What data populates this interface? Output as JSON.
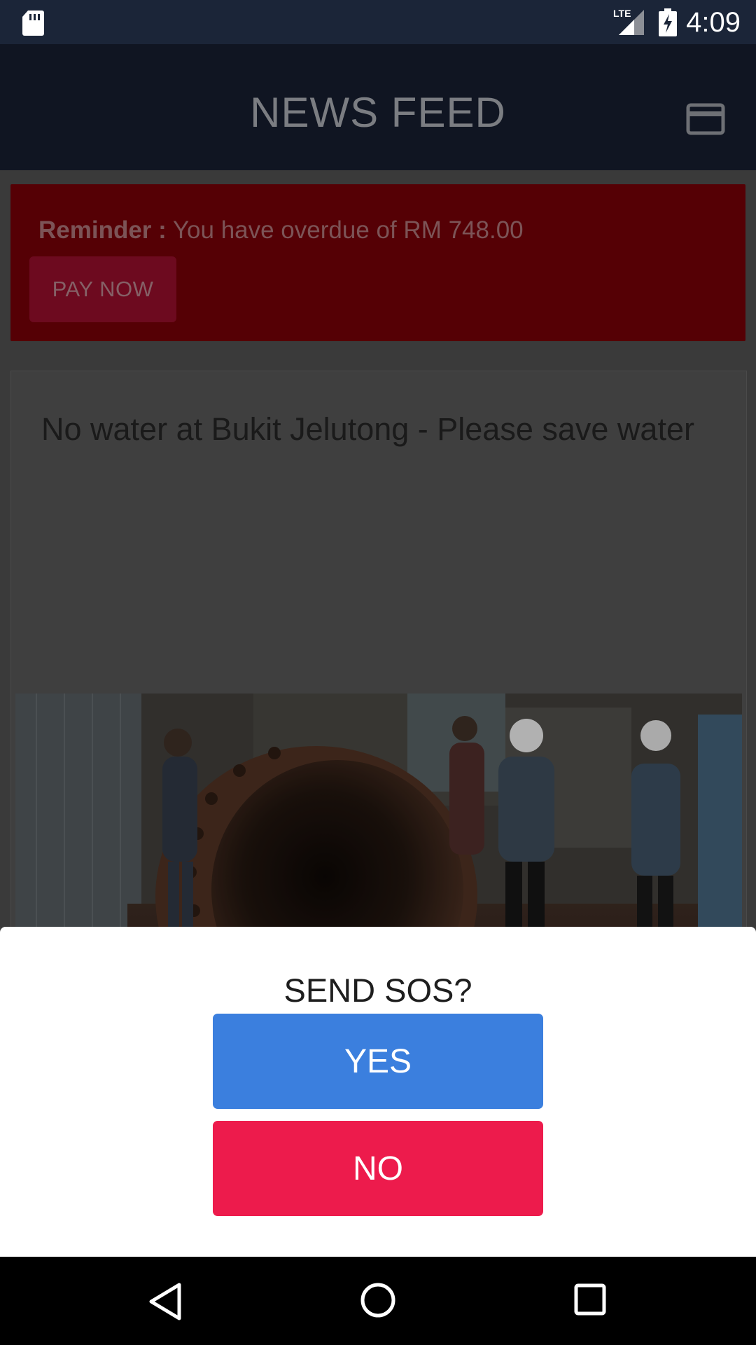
{
  "status_bar": {
    "time": "4:09",
    "network": "LTE",
    "icons": [
      "sd-card-icon",
      "lte-signal-icon",
      "battery-charging-icon"
    ]
  },
  "app_bar": {
    "title": "NEWS FEED",
    "menu_icon": "credit-card-icon"
  },
  "reminder": {
    "label": "Reminder :",
    "message": " You have overdue of RM 748.00",
    "pay_button": "PAY NOW"
  },
  "news": {
    "title": "No water at Bukit Jelutong  - Please save water",
    "image_alt": "Workers around a large burst water pipe"
  },
  "dialog": {
    "title": "SEND SOS?",
    "yes": "YES",
    "no": "NO"
  },
  "nav": {
    "icons": [
      "back-icon",
      "home-icon",
      "recents-icon"
    ]
  },
  "colors": {
    "yes_button": "#3b7fde",
    "no_button": "#ed1b4c",
    "status_bar": "#1b2538",
    "app_bar": "#101522",
    "reminder_bg": "#550005"
  }
}
